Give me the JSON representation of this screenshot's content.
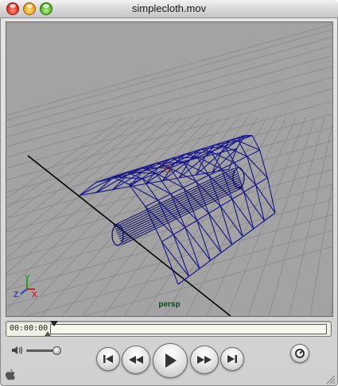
{
  "window": {
    "title": "simplecloth.mov"
  },
  "viewport": {
    "camera_label": "persp",
    "axes": {
      "x": "X",
      "y": "Y",
      "z": "Z"
    }
  },
  "controls": {
    "timecode": "00:00:00",
    "playhead_position": 0,
    "volume_level": 0.8
  },
  "colors": {
    "wireframe": "#14148c",
    "viewport_bg": "#a3a3a3",
    "camera_label": "#0a4a12",
    "timeline_bg": "#f0f1e4"
  },
  "icons": [
    "close-button",
    "minimize-button",
    "zoom-button",
    "speaker-icon",
    "skip-to-start-icon",
    "rewind-icon",
    "play-icon",
    "fast-forward-icon",
    "skip-to-end-icon",
    "options-icon",
    "apple-icon",
    "resize-grip-icon"
  ]
}
